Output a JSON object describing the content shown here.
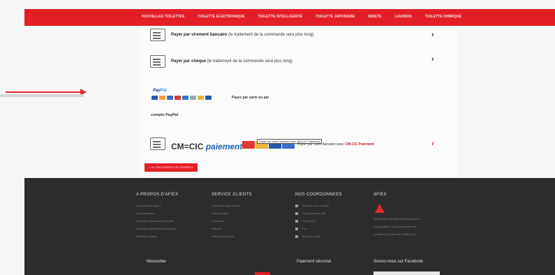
{
  "nav": {
    "links": [
      "NOUVELLES TOILETTES",
      "TOILETTE ELECTRONIQUE",
      "TOILETTE INTELLIGENTE",
      "TOILETTE JAPONAISE",
      "BIDETS",
      "LAVABOS",
      "TOILETTE CHIMIQUE"
    ]
  },
  "payment": {
    "transfer": {
      "bold": "Payer par virement bancaire",
      "rest": " (le traitement de la commande sera plus long)"
    },
    "cheque": {
      "bold": "Payer par chèque",
      "rest": " (le traitement de la commande sera plus long)"
    },
    "paypal": {
      "logo_a": "Pay",
      "logo_b": "Pal",
      "text": "Payez par carte ou par",
      "sub": "compte PayPal"
    },
    "cmcic": {
      "logo_a": "CM",
      "logo_b": "CIC",
      "logo_c": "paiement",
      "tooltip": "Payer par carte bancaire avec CM-CIC Paiement",
      "text_a": "Payer par carte bancaire avec ",
      "text_b": "CM-CIC Paiement"
    },
    "back_label": "< AUTRES MODES DE PAIEMENT",
    "chevron": "›",
    "card_colors": [
      "#2b5aa8",
      "#f2a23a",
      "#3b6fc9",
      "#d13a2e",
      "#2e78c8",
      "#9aa7b5",
      "#e8b43a",
      "#1c58a8",
      "#e03a2e"
    ]
  },
  "footer": {
    "about": {
      "heading": "A PROPOS D'AFIEX",
      "links": [
        "Qui sommes-nous ?",
        "Nos conditions",
        "Conditions générales de vente",
        "Conditions générales d'utilisation",
        "Mentions légales"
      ]
    },
    "service": {
      "heading": "SERVICE CLIENTS",
      "links": [
        "Contacter notre service",
        "Votre compte",
        "Livraisons",
        "Retours",
        "Paiement sécurisé"
      ]
    },
    "contact": {
      "heading": "NOS COORDONNEES",
      "items": [
        "Adresse de la société",
        "Code postal et ville",
        "Téléphone",
        "Fax",
        "Adresse email"
      ]
    },
    "afiex": {
      "heading": "AFIEX",
      "desc": [
        "Spécialiste des toilettes électroniques",
        "et japonaises, nous proposons des",
        "produits de qualité au meilleur prix"
      ]
    },
    "bottom": {
      "newsletter": "Newsletter",
      "secure": "Paiement sécurisé",
      "facebook": "Suivez-nous sur Facebook"
    }
  },
  "colors": {
    "accent": "#e31f26",
    "footer_bg": "#2c2c2c",
    "paypal_blue": "#1d3f8f"
  }
}
